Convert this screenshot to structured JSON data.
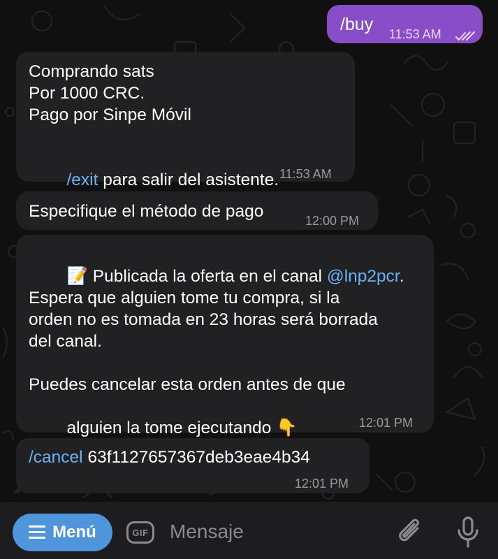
{
  "messages": {
    "buy": {
      "text": "/buy",
      "time": "11:53 AM"
    },
    "buying": {
      "line1": "Comprando sats",
      "line2": "Por 1000 CRC.",
      "line3": "Pago por Sinpe Móvil",
      "exit_cmd": "/exit",
      "exit_text": " para salir del asistente.",
      "time": "11:53 AM"
    },
    "method": {
      "text": "Especifique el método de pago",
      "time": "12:00 PM"
    },
    "offer": {
      "emoji": "📝",
      "line1_text": " Publicada la oferta en el canal ",
      "channel": "@lnp2pcr",
      "line1_end": ".",
      "line2": "Espera que alguien tome tu compra, si la",
      "line3": "orden no es tomada en 23 horas será borrada",
      "line4": "del canal.",
      "line5": "Puedes cancelar esta orden antes de que",
      "line6": "alguien la tome ejecutando ",
      "pointer_emoji": "👇",
      "time": "12:01 PM"
    },
    "cancel": {
      "cmd": "/cancel",
      "order_id": " 63f1127657367deb3eae4b34",
      "time": "12:01 PM"
    }
  },
  "input_bar": {
    "menu_label": "Menú",
    "gif_label": "GIF",
    "placeholder": "Mensaje",
    "icons": [
      "menu-icon",
      "gif-icon",
      "attach-icon",
      "mic-icon"
    ]
  },
  "colors": {
    "outgoing_bubble": "#8a4dc8",
    "incoming_bubble": "#212123",
    "link": "#6ab2f2",
    "menu_button": "#4f95dc"
  }
}
